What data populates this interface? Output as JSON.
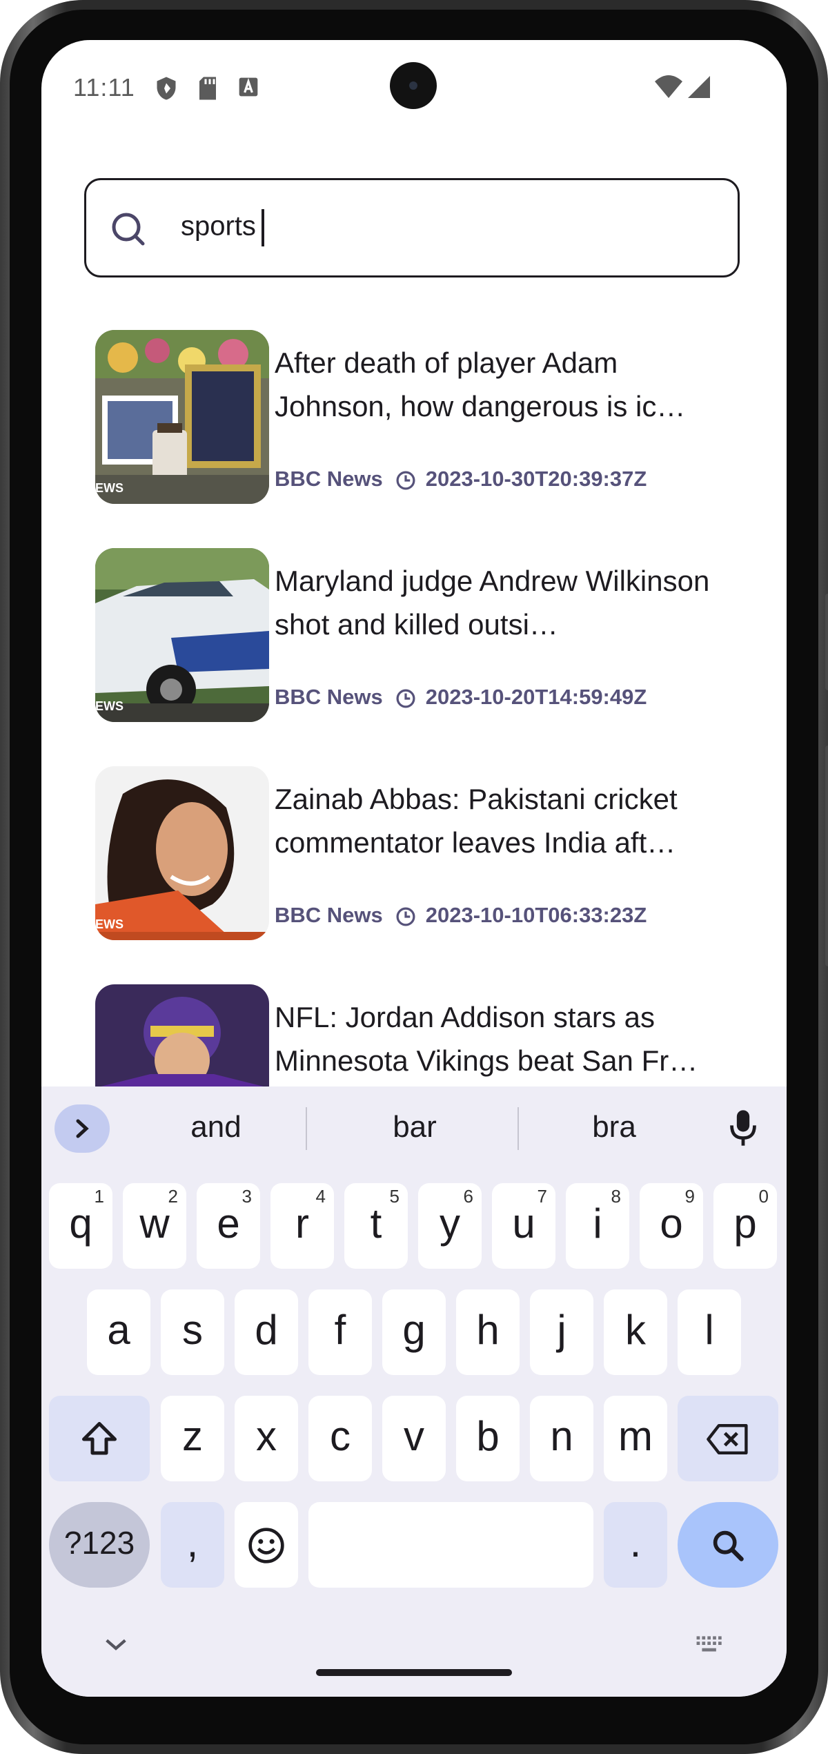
{
  "status_bar": {
    "time": "11:11",
    "icons": [
      "shield-icon",
      "sd-card-icon",
      "a-box-icon",
      "wifi-icon",
      "signal-icon"
    ]
  },
  "search": {
    "value": "sports",
    "icon": "search-icon"
  },
  "articles": [
    {
      "title": "After death of player Adam Johnson, how dangerous is ic…",
      "source": "BBC News",
      "published": "2023-10-30T20:39:37Z",
      "thumb_tag": "EWS"
    },
    {
      "title": "Maryland judge Andrew Wilkinson shot and killed outsi…",
      "source": "BBC News",
      "published": "2023-10-20T14:59:49Z",
      "thumb_tag": "EWS"
    },
    {
      "title": "Zainab Abbas: Pakistani cricket commentator leaves India aft…",
      "source": "BBC News",
      "published": "2023-10-10T06:33:23Z",
      "thumb_tag": "EWS"
    },
    {
      "title": "NFL: Jordan Addison stars as Minnesota Vikings beat San Fr…",
      "source": "",
      "published": "",
      "thumb_tag": ""
    }
  ],
  "keyboard": {
    "suggestions": [
      "and",
      "bar",
      "bra"
    ],
    "row1": [
      {
        "k": "q",
        "n": "1"
      },
      {
        "k": "w",
        "n": "2"
      },
      {
        "k": "e",
        "n": "3"
      },
      {
        "k": "r",
        "n": "4"
      },
      {
        "k": "t",
        "n": "5"
      },
      {
        "k": "y",
        "n": "6"
      },
      {
        "k": "u",
        "n": "7"
      },
      {
        "k": "i",
        "n": "8"
      },
      {
        "k": "o",
        "n": "9"
      },
      {
        "k": "p",
        "n": "0"
      }
    ],
    "row2": [
      "a",
      "s",
      "d",
      "f",
      "g",
      "h",
      "j",
      "k",
      "l"
    ],
    "row3": [
      "z",
      "x",
      "c",
      "v",
      "b",
      "n",
      "m"
    ],
    "symbols_label": "?123",
    "comma_label": ",",
    "period_label": ".",
    "space_label": ""
  },
  "colors": {
    "accent": "#56527a",
    "keyboard_bg": "#eeedf6",
    "enter_key": "#a9c4fb",
    "modifier_key": "#dde1f6"
  }
}
